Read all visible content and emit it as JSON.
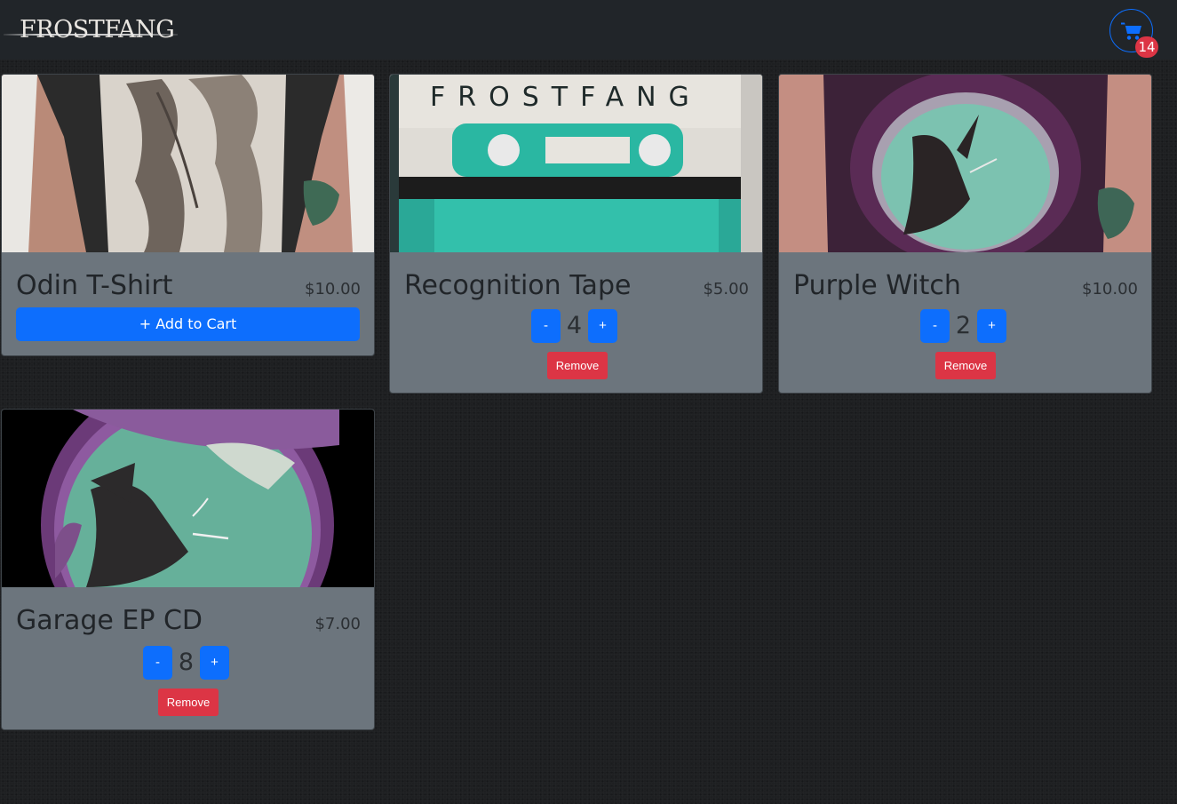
{
  "brand": {
    "logo_text": "FROSTFANG"
  },
  "cart": {
    "icon": "shopping-cart-icon",
    "count": "14"
  },
  "colors": {
    "navbar": "#212529",
    "card": "#6c757d",
    "primary": "#0d6efd",
    "danger": "#dc3545"
  },
  "products": [
    {
      "title": "Odin T-Shirt",
      "price": "$10.00",
      "add_label": "+ Add to Cart"
    },
    {
      "title": "Recognition Tape",
      "price": "$5.00",
      "quantity": "4",
      "minus_label": "-",
      "plus_label": "+",
      "remove_label": "Remove",
      "image_text": "FROSTFANG"
    },
    {
      "title": "Purple Witch",
      "price": "$10.00",
      "quantity": "2",
      "minus_label": "-",
      "plus_label": "+",
      "remove_label": "Remove"
    },
    {
      "title": "Garage EP CD",
      "price": "$7.00",
      "quantity": "8",
      "minus_label": "-",
      "plus_label": "+",
      "remove_label": "Remove"
    }
  ]
}
